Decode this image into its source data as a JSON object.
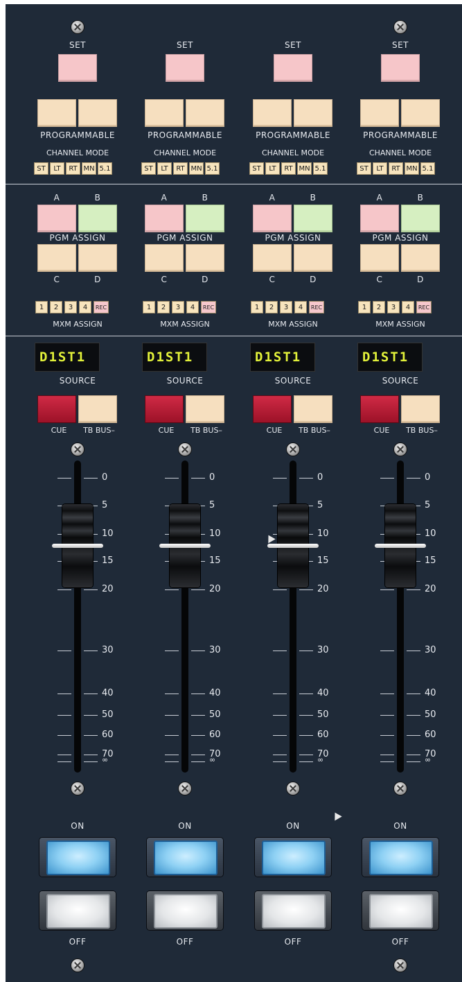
{
  "labels": {
    "set": "SET",
    "programmable": "PROGRAMMABLE",
    "channel_mode": "CHANNEL MODE",
    "a": "A",
    "b": "B",
    "c": "C",
    "d": "D",
    "pgm_assign": "PGM ASSIGN",
    "mxm_assign": "MXM ASSIGN",
    "source": "SOURCE",
    "cue": "CUE",
    "tb_bus": "TB BUS–",
    "on": "ON",
    "off": "OFF"
  },
  "channel_modes": [
    "ST",
    "LT",
    "RT",
    "MN",
    "5.1"
  ],
  "mxm_buttons": [
    "1",
    "2",
    "3",
    "4",
    "REC"
  ],
  "fader_scale": [
    "0",
    "5",
    "10",
    "15",
    "20",
    "30",
    "40",
    "50",
    "60",
    "70",
    "∞"
  ],
  "channels": [
    {
      "display": "D1ST1",
      "fader_level_db": 12
    },
    {
      "display": "D1ST1",
      "fader_level_db": 12
    },
    {
      "display": "D1ST1",
      "fader_level_db": 12
    },
    {
      "display": "D1ST1",
      "fader_level_db": 12
    }
  ],
  "colors": {
    "panel": "#1f2a38",
    "set_button": "#f6c6c9",
    "programmable_button": "#f6dfbf",
    "pgm_a": "#f6c6c9",
    "pgm_b": "#d6efc1",
    "cue_button": "#c01c36",
    "display_text": "#e3f23a",
    "on_lens": "#8fd1f4",
    "off_lens": "#e4e6e8"
  }
}
